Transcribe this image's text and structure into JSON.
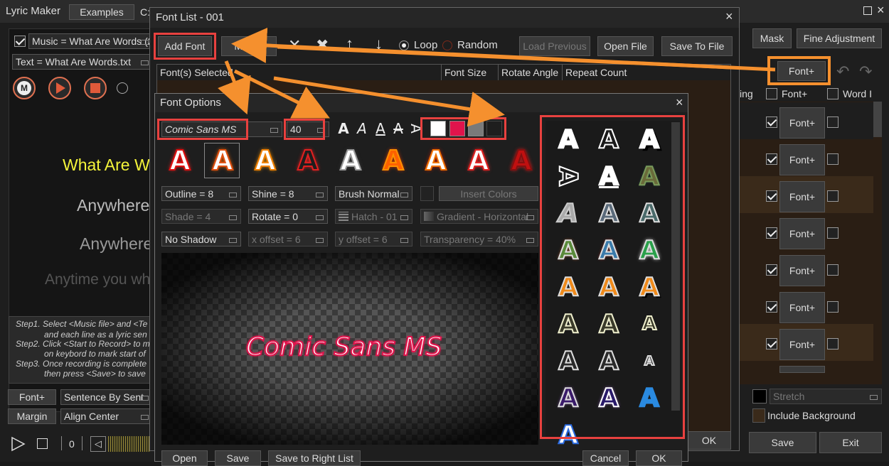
{
  "main": {
    "title": "Lyric Maker",
    "examples_label": "Examples",
    "path_prefix": "C:",
    "music_field": "Music = What Are Words (2)",
    "text_field": "Text = What Are Words.txt",
    "lyric_lines": [
      "What Are W",
      "Anywhere",
      "Anywhere",
      "Anytime you wh"
    ],
    "steps": [
      "Step1. Select <Music file> and <Te",
      "and each line as a lyric sen",
      "Step2. Click <Start to Record> to m",
      "on keybord to mark start of",
      "Step3. Once recording is complete",
      "then press <Save> to save"
    ],
    "font_plus": "Font+",
    "sentence_mode": "Sentence By Sent",
    "margin": "Margin",
    "align": "Align Center",
    "counter": "0",
    "mask": "Mask",
    "fine_adjustment": "Fine Adjustment",
    "right_fontplus": "Font+",
    "col_ing": "ing",
    "col_fontplus": "Font+",
    "col_word": "Word I",
    "row_fontplus": [
      "Font+",
      "Font+",
      "Font+",
      "Font+",
      "Font+",
      "Font+",
      "Font+"
    ],
    "stretch": "Stretch",
    "include_background": "Include Background",
    "save": "Save",
    "exit": "Exit"
  },
  "font_list": {
    "title": "Font List - 001",
    "add_font": "Add Font",
    "modify": "Modify",
    "loop": "Loop",
    "random": "Random",
    "load_previous": "Load Previous",
    "open_file": "Open File",
    "save_to_file": "Save To File",
    "columns": [
      "Font(s) Selected",
      "Font Size",
      "Rotate Angle",
      "Repeat Count"
    ],
    "ok": "OK"
  },
  "font_options": {
    "title": "Font Options",
    "font_name": "Comic Sans MS",
    "font_size": "40",
    "colors": [
      "#ffffff",
      "#e0144c",
      "#7a7a7a"
    ],
    "outline": "Outline = 8",
    "shine": "Shine = 8",
    "brush": "Brush Normal",
    "insert_colors": "Insert Colors",
    "shade": "Shade = 4",
    "rotate": "Rotate = 0",
    "hatch": "Hatch - 01",
    "gradient": "Gradient - Horizontal",
    "shadow": "No Shadow",
    "x_offset": "x offset = 6",
    "y_offset": "y offset = 6",
    "transparency": "Transparency = 40%",
    "preview_text": "Comic Sans MS",
    "open": "Open",
    "save": "Save",
    "save_right": "Save to Right List",
    "cancel": "Cancel",
    "ok": "OK"
  },
  "glyph": "A"
}
